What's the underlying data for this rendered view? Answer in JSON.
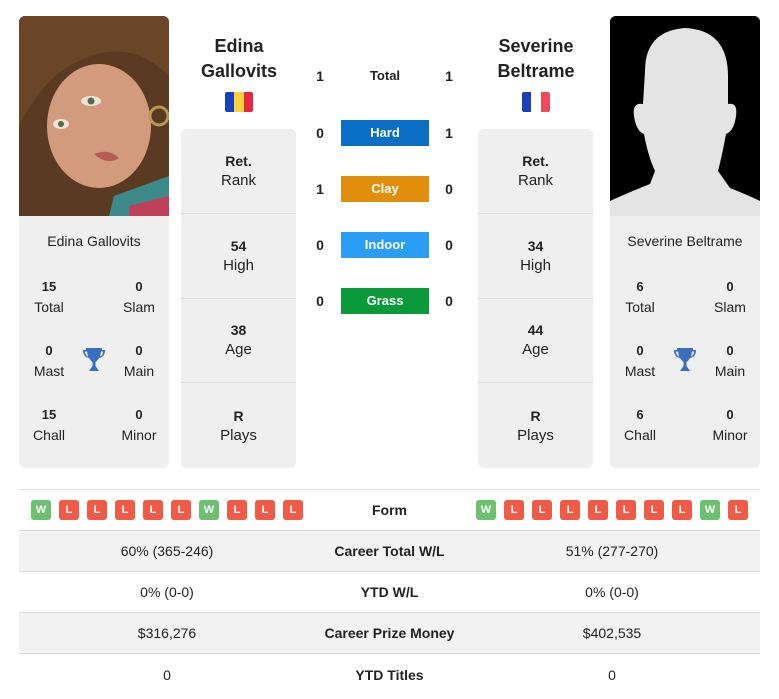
{
  "colors": {
    "hard": "#0a6ec7",
    "clay": "#e08e0b",
    "indoor": "#2a9df4",
    "grass": "#0b9a3a",
    "win": "#6cc070",
    "loss": "#ef5b46",
    "trophy": "#3a6fc0"
  },
  "player_left": {
    "name_line1": "Edina",
    "name_line2": "Gallovits",
    "full_name": "Edina Gallovits",
    "flag": "romania-flag",
    "titles": {
      "total": {
        "value": "15",
        "label": "Total"
      },
      "slam": {
        "value": "0",
        "label": "Slam"
      },
      "mast": {
        "value": "0",
        "label": "Mast"
      },
      "main": {
        "value": "0",
        "label": "Main"
      },
      "chall": {
        "value": "15",
        "label": "Chall"
      },
      "minor": {
        "value": "0",
        "label": "Minor"
      }
    },
    "info": [
      {
        "value": "Ret.",
        "label": "Rank"
      },
      {
        "value": "54",
        "label": "High"
      },
      {
        "value": "38",
        "label": "Age"
      },
      {
        "value": "R",
        "label": "Plays"
      }
    ],
    "form": [
      "W",
      "L",
      "L",
      "L",
      "L",
      "L",
      "W",
      "L",
      "L",
      "L"
    ],
    "career_wl": "60% (365-246)",
    "ytd_wl": "0% (0-0)",
    "prize_money": "$316,276",
    "ytd_titles": "0"
  },
  "player_right": {
    "name_line1": "Severine",
    "name_line2": "Beltrame",
    "full_name": "Severine Beltrame",
    "flag": "france-flag",
    "titles": {
      "total": {
        "value": "6",
        "label": "Total"
      },
      "slam": {
        "value": "0",
        "label": "Slam"
      },
      "mast": {
        "value": "0",
        "label": "Mast"
      },
      "main": {
        "value": "0",
        "label": "Main"
      },
      "chall": {
        "value": "6",
        "label": "Chall"
      },
      "minor": {
        "value": "0",
        "label": "Minor"
      }
    },
    "info": [
      {
        "value": "Ret.",
        "label": "Rank"
      },
      {
        "value": "34",
        "label": "High"
      },
      {
        "value": "44",
        "label": "Age"
      },
      {
        "value": "R",
        "label": "Plays"
      }
    ],
    "form": [
      "W",
      "L",
      "L",
      "L",
      "L",
      "L",
      "L",
      "L",
      "W",
      "L"
    ],
    "career_wl": "51% (277-270)",
    "ytd_wl": "0% (0-0)",
    "prize_money": "$402,535",
    "ytd_titles": "0"
  },
  "h2h": [
    {
      "label": "Total",
      "left": "1",
      "right": "1",
      "surface": "total"
    },
    {
      "label": "Hard",
      "left": "0",
      "right": "1",
      "surface": "hard"
    },
    {
      "label": "Clay",
      "left": "1",
      "right": "0",
      "surface": "clay"
    },
    {
      "label": "Indoor",
      "left": "0",
      "right": "0",
      "surface": "indoor"
    },
    {
      "label": "Grass",
      "left": "0",
      "right": "0",
      "surface": "grass"
    }
  ],
  "table_labels": {
    "form": "Form",
    "career_wl": "Career Total W/L",
    "ytd_wl": "YTD W/L",
    "prize_money": "Career Prize Money",
    "ytd_titles": "YTD Titles"
  }
}
